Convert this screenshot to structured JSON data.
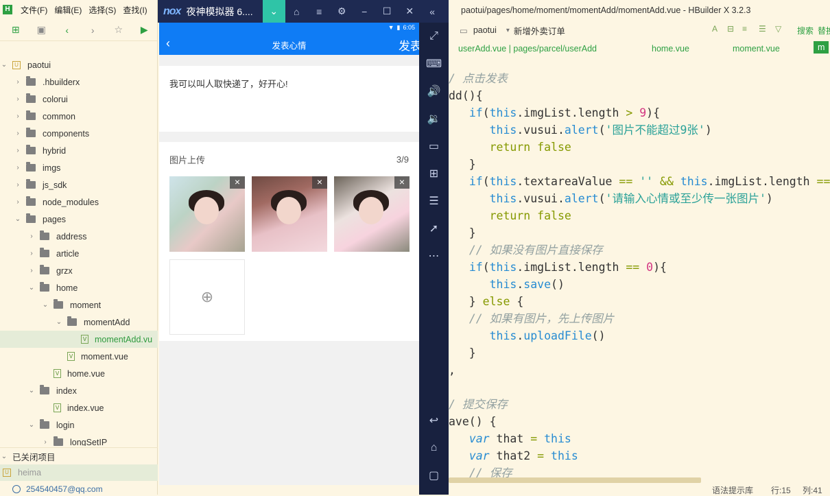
{
  "hbuilder": {
    "logo": "H",
    "menu": [
      "文件(F)",
      "编辑(E)",
      "选择(S)",
      "查找(I)"
    ],
    "tree": [
      {
        "depth": 0,
        "arrow": "⌄",
        "type": "project",
        "label": "paotui"
      },
      {
        "depth": 1,
        "arrow": "›",
        "type": "folder",
        "label": ".hbuilderx"
      },
      {
        "depth": 1,
        "arrow": "›",
        "type": "folder",
        "label": "colorui"
      },
      {
        "depth": 1,
        "arrow": "›",
        "type": "folder",
        "label": "common"
      },
      {
        "depth": 1,
        "arrow": "›",
        "type": "folder",
        "label": "components"
      },
      {
        "depth": 1,
        "arrow": "›",
        "type": "folder",
        "label": "hybrid"
      },
      {
        "depth": 1,
        "arrow": "›",
        "type": "folder",
        "label": "imgs"
      },
      {
        "depth": 1,
        "arrow": "›",
        "type": "folder",
        "label": "js_sdk"
      },
      {
        "depth": 1,
        "arrow": "›",
        "type": "folder",
        "label": "node_modules"
      },
      {
        "depth": 1,
        "arrow": "⌄",
        "type": "folder",
        "label": "pages"
      },
      {
        "depth": 2,
        "arrow": "›",
        "type": "folder",
        "label": "address"
      },
      {
        "depth": 2,
        "arrow": "›",
        "type": "folder",
        "label": "article"
      },
      {
        "depth": 2,
        "arrow": "›",
        "type": "folder",
        "label": "grzx"
      },
      {
        "depth": 2,
        "arrow": "⌄",
        "type": "folder",
        "label": "home"
      },
      {
        "depth": 3,
        "arrow": "⌄",
        "type": "folder",
        "label": "moment"
      },
      {
        "depth": 4,
        "arrow": "⌄",
        "type": "folder",
        "label": "momentAdd"
      },
      {
        "depth": 5,
        "arrow": "",
        "type": "file",
        "label": "momentAdd.vu",
        "selected": true
      },
      {
        "depth": 4,
        "arrow": "",
        "type": "file",
        "label": "moment.vue"
      },
      {
        "depth": 3,
        "arrow": "",
        "type": "file",
        "label": "home.vue"
      },
      {
        "depth": 2,
        "arrow": "⌄",
        "type": "folder",
        "label": "index"
      },
      {
        "depth": 3,
        "arrow": "",
        "type": "file",
        "label": "index.vue"
      },
      {
        "depth": 2,
        "arrow": "⌄",
        "type": "folder",
        "label": "login"
      },
      {
        "depth": 3,
        "arrow": "›",
        "type": "folder",
        "label": "longSetIP"
      }
    ],
    "closed_projects": "已关闭项目",
    "closed_item": "heima",
    "account": "254540457@qq.com"
  },
  "emulator": {
    "brand": "nox",
    "title": "夜神模拟器 6....",
    "status_time": "6:05",
    "page_title": "发表心情",
    "submit_label": "发表",
    "note_text": "我可以叫人取快递了，好开心!",
    "upload_label": "图片上传",
    "upload_count": "3/9",
    "close_glyph": "×"
  },
  "editor": {
    "window_title": "paotui/pages/home/moment/momentAdd/momentAdd.vue - HBuilder X 3.2.3",
    "project": "paotui",
    "new_order": "新增外卖订单",
    "search": "搜索",
    "replace": "替换",
    "tabs": [
      "userAdd.vue | pages/parcel/userAdd",
      "home.vue",
      "moment.vue",
      "m"
    ],
    "status_hint": "语法提示库",
    "status_row": "行:15",
    "status_col": "列:41"
  }
}
